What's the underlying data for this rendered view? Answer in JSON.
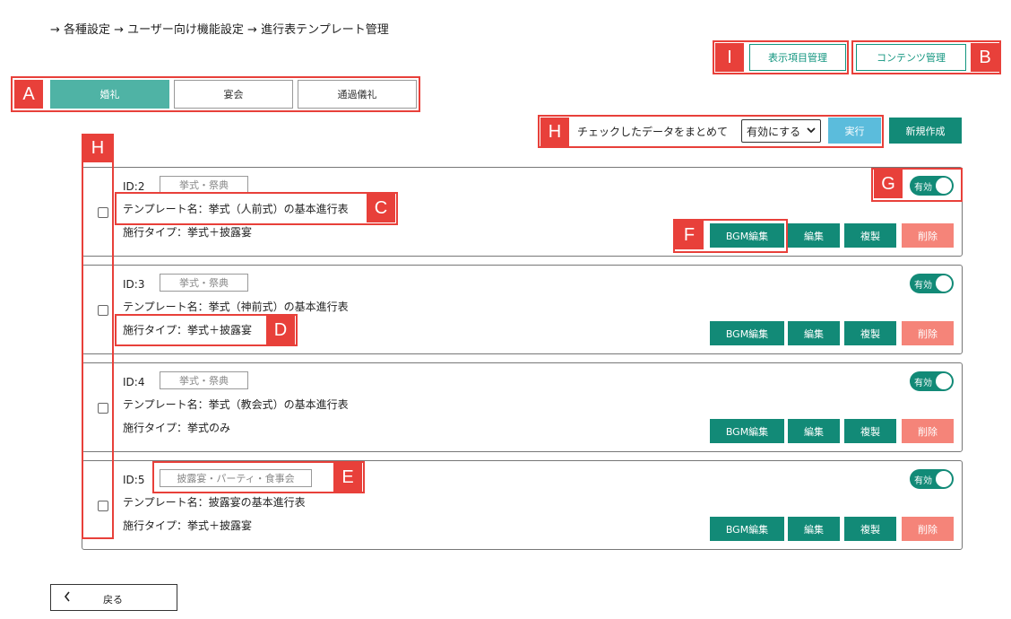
{
  "breadcrumb": "→ 各種設定 → ユーザー向け機能設定 → 進行表テンプレート管理",
  "top_buttons": {
    "display_items": "表示項目管理",
    "contents": "コンテンツ管理"
  },
  "tabs": [
    {
      "label": "婚礼",
      "active": true
    },
    {
      "label": "宴会",
      "active": false
    },
    {
      "label": "通過儀礼",
      "active": false
    }
  ],
  "bulk": {
    "label": "チェックしたデータをまとめて",
    "selected": "有効にする",
    "run": "実行",
    "new": "新規作成"
  },
  "templates": [
    {
      "id": "ID:2",
      "category": "挙式・祭典",
      "name": "テンプレート名：挙式（人前式）の基本進行表",
      "type": "施行タイプ：挙式＋披露宴",
      "status": "有効"
    },
    {
      "id": "ID:3",
      "category": "挙式・祭典",
      "name": "テンプレート名：挙式（神前式）の基本進行表",
      "type": "施行タイプ：挙式＋披露宴",
      "status": "有効"
    },
    {
      "id": "ID:4",
      "category": "挙式・祭典",
      "name": "テンプレート名：挙式（教会式）の基本進行表",
      "type": "施行タイプ：挙式のみ",
      "status": "有効"
    },
    {
      "id": "ID:5",
      "category": "披露宴・パーティ・食事会",
      "name": "テンプレート名：披露宴の基本進行表",
      "type": "施行タイプ：挙式＋披露宴",
      "status": "有効"
    }
  ],
  "row_actions": {
    "bgm": "BGM編集",
    "edit": "編集",
    "copy": "複製",
    "delete": "削除"
  },
  "back": "戻る",
  "markers": {
    "A": "A",
    "B": "B",
    "C": "C",
    "D": "D",
    "E": "E",
    "F": "F",
    "G": "G",
    "H": "H",
    "I": "I"
  },
  "colors": {
    "primary": "#128a77",
    "active_tab": "#4fb3a5",
    "run_button": "#5bbcdc",
    "delete_button": "#f58479",
    "annotation": "#e8403a"
  }
}
